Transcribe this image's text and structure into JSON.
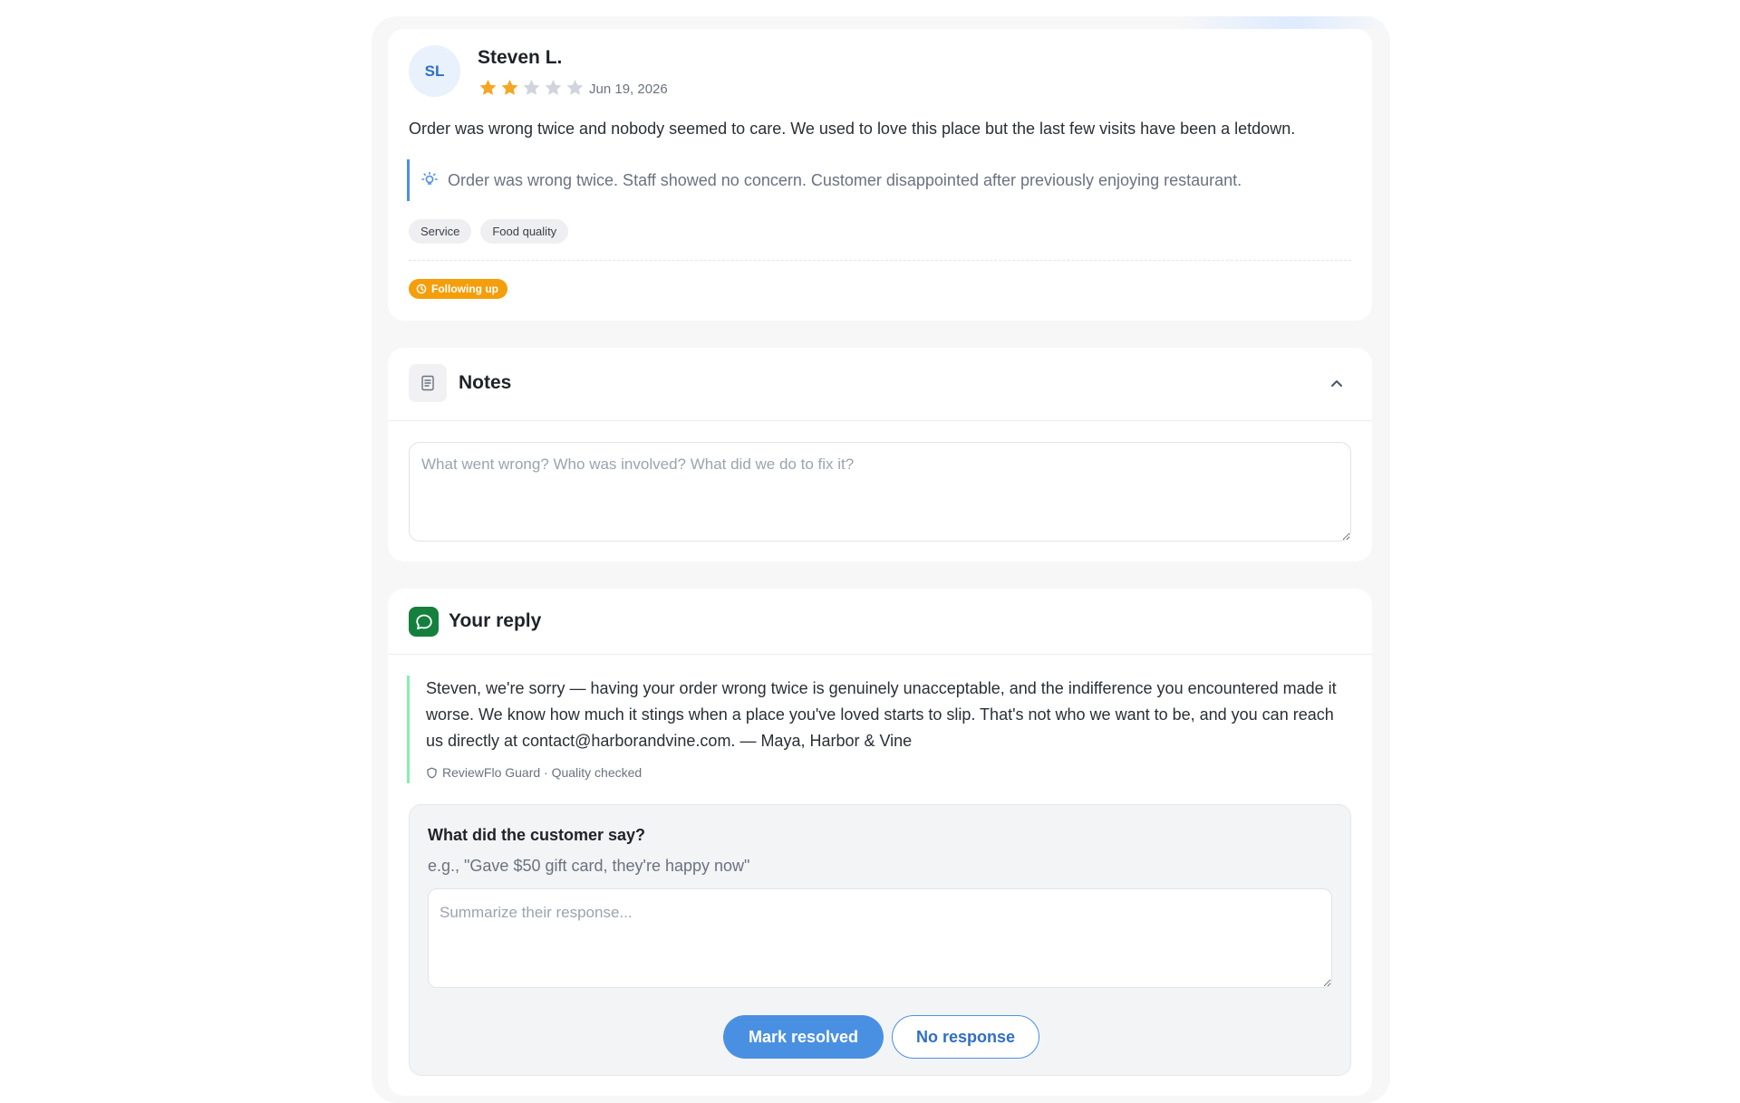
{
  "colors": {
    "accent": "#4a90e2",
    "star_filled": "#f5a623",
    "star_empty": "#d1d5db",
    "status_following_up": "#f59e0b",
    "reply_green": "#15803d"
  },
  "review": {
    "avatar_initials": "SL",
    "reviewer_name": "Steven L.",
    "rating": 2,
    "rating_max": 5,
    "date": "Jun 19, 2026",
    "text": "Order was wrong twice and nobody seemed to care. We used to love this place but the last few visits have been a letdown.",
    "summary_icon": "lightbulb-icon",
    "summary": "Order was wrong twice. Staff showed no concern. Customer disappointed after previously enjoying restaurant.",
    "tags": [
      "Service",
      "Food quality"
    ],
    "status_icon": "clock-icon",
    "status": "Following up"
  },
  "notes": {
    "icon": "document-icon",
    "title": "Notes",
    "toggle_icon": "chevron-up-icon",
    "placeholder": "What went wrong? Who was involved? What did we do to fix it?",
    "value": ""
  },
  "reply": {
    "icon": "chat-bubble-icon",
    "title": "Your reply",
    "text": "Steven, we're sorry — having your order wrong twice is genuinely unacceptable, and the indifference you encountered made it worse. We know how much it stings when a place you've loved starts to slip. That's not who we want to be, and you can reach us directly at contact@harborandvine.com. — Maya, Harbor & Vine",
    "guard_icon": "shield-icon",
    "guard_label": "ReviewFlo Guard · Quality checked"
  },
  "followup": {
    "question": "What did the customer say?",
    "hint": "e.g., \"Gave $50 gift card, they're happy now\"",
    "placeholder": "Summarize their response...",
    "value": "",
    "mark_resolved_label": "Mark resolved",
    "no_response_label": "No response"
  }
}
